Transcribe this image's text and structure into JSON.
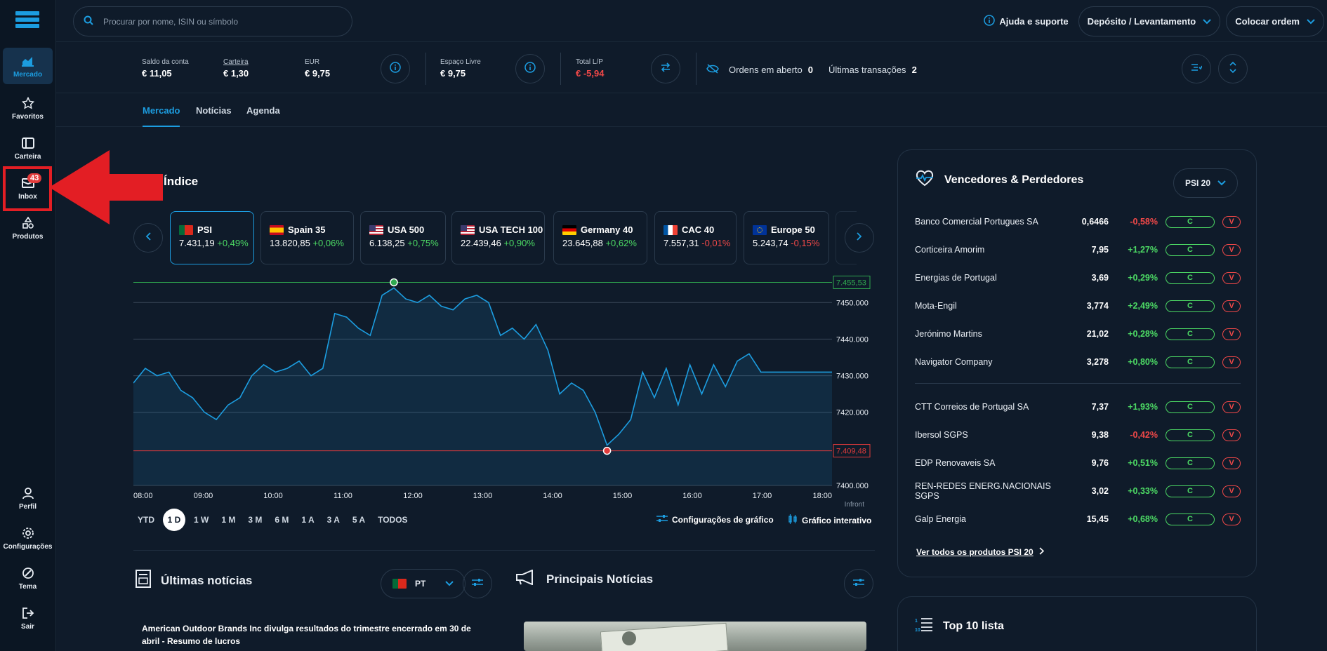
{
  "sidebar": {
    "items": [
      {
        "label": "Mercado",
        "icon": "chart-icon"
      },
      {
        "label": "Favoritos",
        "icon": "star-icon"
      },
      {
        "label": "Carteira",
        "icon": "wallet-icon"
      },
      {
        "label": "Inbox",
        "icon": "mail-icon",
        "badge": "43"
      },
      {
        "label": "Produtos",
        "icon": "shapes-icon"
      },
      {
        "label": "Perfil",
        "icon": "user-icon"
      },
      {
        "label": "Configurações",
        "icon": "gear-icon"
      },
      {
        "label": "Tema",
        "icon": "palette-icon"
      },
      {
        "label": "Sair",
        "icon": "logout-icon"
      }
    ]
  },
  "search": {
    "placeholder": "Procurar por nome, ISIN ou símbolo"
  },
  "header": {
    "help": "Ajuda e suporte",
    "deposit": "Depósito / Levantamento",
    "order": "Colocar ordem"
  },
  "account": {
    "saldo_label": "Saldo da conta",
    "saldo": "€ 11,05",
    "carteira_label": "Carteira",
    "carteira": "€ 1,30",
    "eur_label": "EUR",
    "eur": "€ 9,75",
    "espaco_label": "Espaço Livre",
    "espaco": "€ 9,75",
    "total_label": "Total L/P",
    "total": "€ -5,94",
    "ordens_label": "Ordens em aberto",
    "ordens": "0",
    "transacoes_label": "Últimas transações",
    "transacoes": "2"
  },
  "tabs": [
    "Mercado",
    "Notícias",
    "Agenda"
  ],
  "index_section": {
    "title": "Índice",
    "cards": [
      {
        "name": "PSI",
        "price": "7.431,19",
        "change": "+0,49%",
        "flag": "pt"
      },
      {
        "name": "Spain 35",
        "price": "13.820,85",
        "change": "+0,06%",
        "flag": "es"
      },
      {
        "name": "USA 500",
        "price": "6.138,25",
        "change": "+0,75%",
        "flag": "us"
      },
      {
        "name": "USA TECH 100",
        "price": "22.439,46",
        "change": "+0,90%",
        "flag": "us"
      },
      {
        "name": "Germany 40",
        "price": "23.645,88",
        "change": "+0,62%",
        "flag": "de"
      },
      {
        "name": "CAC 40",
        "price": "7.557,31",
        "change": "-0,01%",
        "flag": "fr"
      },
      {
        "name": "Europe 50",
        "price": "5.243,74",
        "change": "-0,15%",
        "flag": "eu"
      }
    ]
  },
  "chart_data": {
    "type": "area",
    "series": [
      {
        "values": [
          7428,
          7432,
          7430,
          7431,
          7426,
          7424,
          7420,
          7418,
          7422,
          7424,
          7430,
          7433,
          7431,
          7432,
          7434,
          7430,
          7432,
          7447,
          7446,
          7443,
          7441,
          7452,
          7454,
          7451,
          7450,
          7452,
          7449,
          7448,
          7451,
          7452,
          7450,
          7441,
          7443,
          7440,
          7444,
          7437,
          7425,
          7428,
          7426,
          7420,
          7411,
          7414,
          7418,
          7431,
          7424,
          7432,
          7422,
          7433,
          7425,
          7433,
          7427,
          7434,
          7436,
          7431,
          7431,
          7431,
          7431,
          7431,
          7431,
          7431
        ]
      }
    ],
    "x_ticks": [
      "08:00",
      "09:00",
      "10:00",
      "11:00",
      "12:00",
      "13:00",
      "14:00",
      "15:00",
      "16:00",
      "17:00",
      "18:00"
    ],
    "y_ticks": [
      "7450.000",
      "7440.000",
      "7430.000",
      "7420.000",
      "7400.000"
    ],
    "high_label": "7.455,53",
    "low_label": "7.409,48",
    "ylim": [
      7400,
      7456
    ],
    "source": "Infront"
  },
  "periods": [
    "YTD",
    "1 D",
    "1 W",
    "1 M",
    "3 M",
    "6 M",
    "1 A",
    "3 A",
    "5 A",
    "TODOS"
  ],
  "chart_tools": {
    "config": "Configurações de gráfico",
    "interactive": "Gráfico interativo"
  },
  "news": {
    "latest_title": "Últimas notícias",
    "lang": "PT",
    "main_title": "Principais Notícias",
    "first_item": "American Outdoor Brands Inc divulga resultados do trimestre encerrado em 30 de abril - Resumo de lucros"
  },
  "movers": {
    "title": "Vencedores & Perdedores",
    "index": "PSI 20",
    "winners": [
      {
        "name": "Banco Comercial Portugues SA",
        "price": "0,6466",
        "change": "-0,58%"
      },
      {
        "name": "Corticeira Amorim",
        "price": "7,95",
        "change": "+1,27%"
      },
      {
        "name": "Energias de Portugal",
        "price": "3,69",
        "change": "+0,29%"
      },
      {
        "name": "Mota-Engil",
        "price": "3,774",
        "change": "+2,49%"
      },
      {
        "name": "Jerónimo Martins",
        "price": "21,02",
        "change": "+0,28%"
      },
      {
        "name": "Navigator Company",
        "price": "3,278",
        "change": "+0,80%"
      }
    ],
    "others": [
      {
        "name": "CTT Correios de Portugal SA",
        "price": "7,37",
        "change": "+1,93%"
      },
      {
        "name": "Ibersol SGPS",
        "price": "9,38",
        "change": "-0,42%"
      },
      {
        "name": "EDP Renovaveis SA",
        "price": "9,76",
        "change": "+0,51%"
      },
      {
        "name": "REN-REDES ENERG.NACIONAIS SGPS",
        "price": "3,02",
        "change": "+0,33%"
      },
      {
        "name": "Galp Energia",
        "price": "15,45",
        "change": "+0,68%"
      }
    ],
    "buy": "C",
    "sell": "V",
    "see_all": "Ver todos os produtos PSI 20"
  },
  "top10": {
    "title": "Top 10 lista"
  }
}
